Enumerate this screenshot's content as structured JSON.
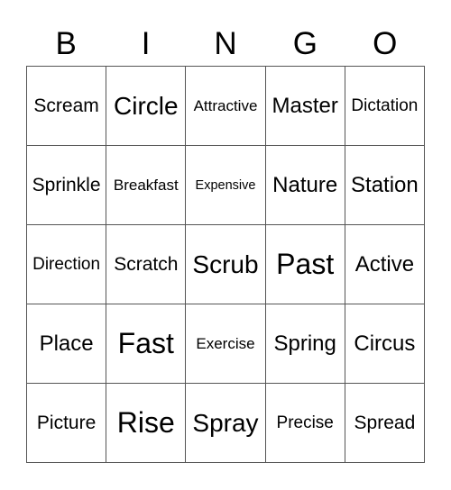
{
  "header": {
    "letters": [
      "B",
      "I",
      "N",
      "G",
      "O"
    ]
  },
  "card": {
    "rows": [
      [
        "Scream",
        "Circle",
        "Attractive",
        "Master",
        "Dictation"
      ],
      [
        "Sprinkle",
        "Breakfast",
        "Expensive",
        "Nature",
        "Station"
      ],
      [
        "Direction",
        "Scratch",
        "Scrub",
        "Past",
        "Active"
      ],
      [
        "Place",
        "Fast",
        "Exercise",
        "Spring",
        "Circus"
      ],
      [
        "Picture",
        "Rise",
        "Spray",
        "Precise",
        "Spread"
      ]
    ]
  }
}
